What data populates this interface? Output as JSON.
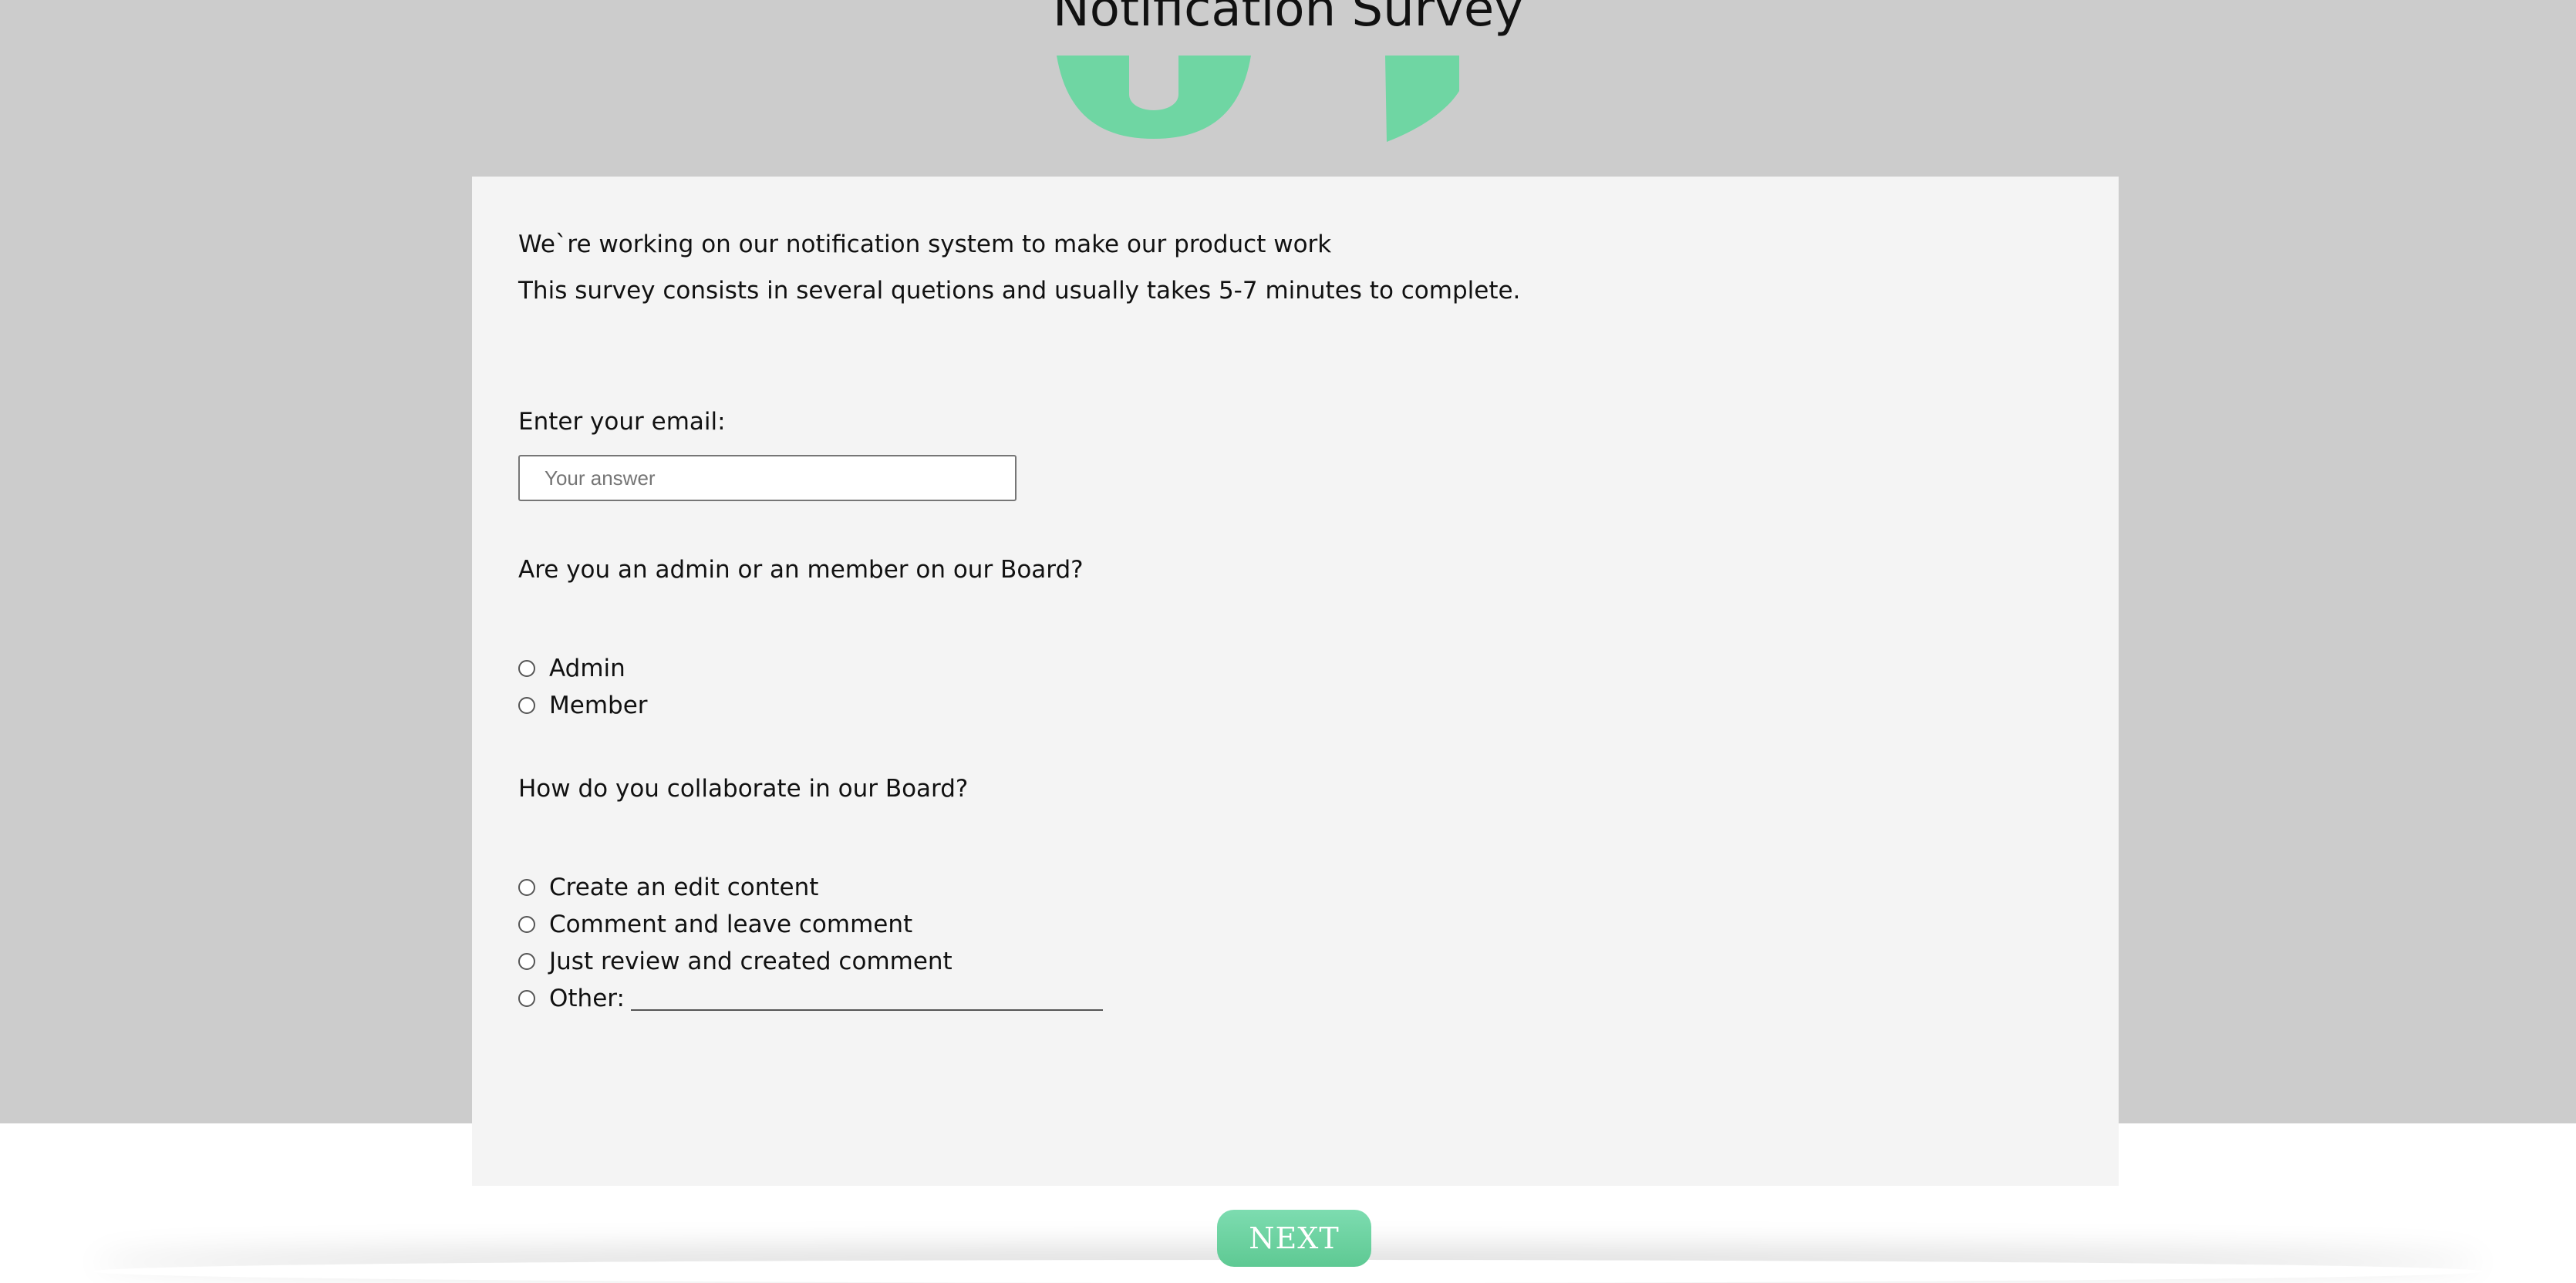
{
  "header": {
    "title": "Notification Survey"
  },
  "logo": {
    "icon": "brand-logo-icon",
    "color": "#6fd6a3"
  },
  "colors": {
    "page_background": "#cccccc",
    "card_background": "#f4f4f4",
    "accent": "#6fd6a3"
  },
  "intro": {
    "line1": "We`re working on our notification system to make our product work",
    "line2": "This survey consists in several quetions and usually takes 5-7 minutes to complete."
  },
  "email": {
    "label": "Enter your email:",
    "placeholder": "Your answer",
    "value": ""
  },
  "role_question": {
    "label": "Are you an admin or an member on our Board?",
    "options": [
      {
        "label": "Admin",
        "selected": false
      },
      {
        "label": "Member",
        "selected": false
      }
    ]
  },
  "collab_question": {
    "label": "How do you collaborate in our Board?",
    "options": [
      {
        "label": "Create an edit content",
        "selected": false
      },
      {
        "label": "Comment and leave comment",
        "selected": false
      },
      {
        "label": "Just review and created comment",
        "selected": false
      },
      {
        "label": "Other:",
        "selected": false
      }
    ]
  },
  "footer": {
    "next_label": "NEXT"
  }
}
